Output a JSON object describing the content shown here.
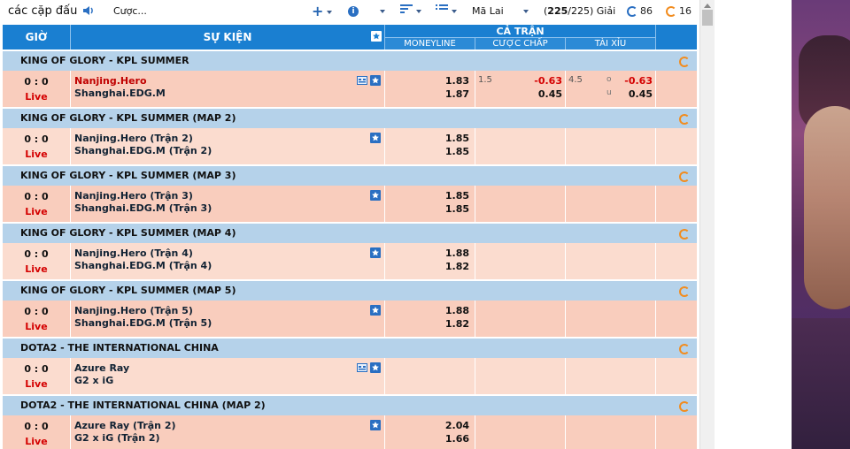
{
  "toolbar": {
    "title": "các cặp đấu",
    "odds_label": "Cược...",
    "odds_type": "Mã Lai",
    "count_display": "(225/225) Giải",
    "count_bold": "225",
    "refresh_count_1": "86",
    "refresh_count_2": "16"
  },
  "header": {
    "time": "GIỜ",
    "event": "SỰ KIỆN",
    "full_match": "CẢ TRẬN",
    "moneyline": "MONEYLINE",
    "handicap": "CƯỢC CHẤP",
    "over_under": "TÀI XỈU"
  },
  "leagues": [
    {
      "name": "KING OF GLORY - KPL SUMMER",
      "match": {
        "score": "0 : 0",
        "status": "Live",
        "team1": "Nanjing.Hero",
        "team2": "Shanghai.EDG.M",
        "ml1": "1.83",
        "ml2": "1.87",
        "hc_line": "1.5",
        "hc1": "-0.63",
        "hc2": "0.45",
        "ou_line": "4.5",
        "ou_over_label": "o",
        "ou_under_label": "u",
        "ou1": "-0.63",
        "ou2": "0.45"
      }
    },
    {
      "name": "KING OF GLORY - KPL SUMMER (MAP 2)",
      "match": {
        "score": "0 : 0",
        "status": "Live",
        "team1": "Nanjing.Hero (Trận 2)",
        "team2": "Shanghai.EDG.M (Trận 2)",
        "ml1": "1.85",
        "ml2": "1.85"
      }
    },
    {
      "name": "KING OF GLORY - KPL SUMMER (MAP 3)",
      "match": {
        "score": "0 : 0",
        "status": "Live",
        "team1": "Nanjing.Hero (Trận 3)",
        "team2": "Shanghai.EDG.M (Trận 3)",
        "ml1": "1.85",
        "ml2": "1.85"
      }
    },
    {
      "name": "KING OF GLORY - KPL SUMMER (MAP 4)",
      "match": {
        "score": "0 : 0",
        "status": "Live",
        "team1": "Nanjing.Hero (Trận 4)",
        "team2": "Shanghai.EDG.M (Trận 4)",
        "ml1": "1.88",
        "ml2": "1.82"
      }
    },
    {
      "name": "KING OF GLORY - KPL SUMMER (MAP 5)",
      "match": {
        "score": "0 : 0",
        "status": "Live",
        "team1": "Nanjing.Hero (Trận 5)",
        "team2": "Shanghai.EDG.M (Trận 5)",
        "ml1": "1.88",
        "ml2": "1.82"
      }
    },
    {
      "name": "DOTA2 - THE INTERNATIONAL CHINA",
      "match": {
        "score": "0 : 0",
        "status": "Live",
        "team1": "Azure Ray",
        "team2": "G2 x iG",
        "ml1": "",
        "ml2": ""
      }
    },
    {
      "name": "DOTA2 - THE INTERNATIONAL CHINA (MAP 2)",
      "match": {
        "score": "0 : 0",
        "status": "Live",
        "team1": "Azure Ray (Trận 2)",
        "team2": "G2 x iG (Trận 2)",
        "ml1": "2.04",
        "ml2": "1.66"
      }
    }
  ],
  "colors": {
    "header_blue": "#1a7fd1",
    "league_bar": "#b5d2ea",
    "row_dark": "#f9cdbd",
    "row_light": "#fbdccf",
    "live_red": "#d40000",
    "refresh_orange": "#f28c1e"
  }
}
